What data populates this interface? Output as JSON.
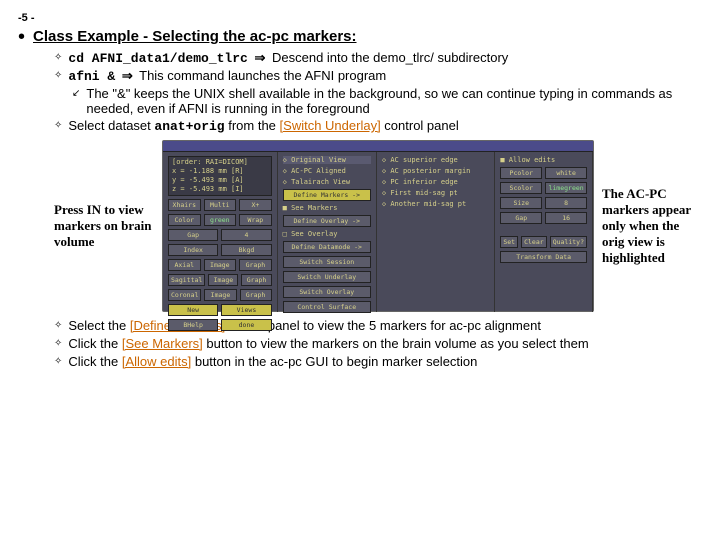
{
  "page_number": "-5 -",
  "title": "Class Example - Selecting the ac-pc markers:",
  "bullets": {
    "cd_cmd": "cd AFNI_data1/demo_tlrc",
    "cd_desc": "Descend into the demo_tlrc/ subdirectory",
    "afni_cmd": "afni &",
    "afni_desc": "This command launches the AFNI program",
    "amp_note": "The \"&\" keeps the UNIX shell available in the background, so we can continue typing in commands as needed, even if AFNI is running in the foreground",
    "select_pre": "Select dataset ",
    "select_ds": "anat+orig",
    "select_mid": " from the ",
    "select_link": "[Switch Underlay]",
    "select_post": " control panel"
  },
  "side_left": "Press IN to view markers on brain volume",
  "side_right": "The AC-PC markers appear only when the orig view is highlighted",
  "bottom": {
    "b1_pre": "Select the ",
    "b1_link": "[Define Markers]",
    "b1_post": "control panel to view the 5 markers for ac-pc alignment",
    "b2_pre": "Click the ",
    "b2_link": "[See Markers]",
    "b2_post": " button to view the markers on the brain volume as you select them",
    "b3_pre": "Click the ",
    "b3_link": "[Allow edits]",
    "b3_post": " button in the ac-pc GUI to begin marker selection"
  },
  "afni": {
    "order": "[order: RAI=DICOM]",
    "coord_x": "x = -1.188 mm [R]",
    "coord_y": "y = -5.493 mm [A]",
    "coord_z": "z = -5.493 mm [I]",
    "xhairs": "Xhairs",
    "multi": "Multi",
    "xl": "X+",
    "color": "Color",
    "green": "green",
    "wrap": "Wrap",
    "gap": "Gap",
    "gap_v": "4",
    "index": "Index",
    "bkgd": "Bkgd",
    "axial": "Axial",
    "image1": "Image",
    "graph1": "Graph",
    "sagittal": "Sagittal",
    "image2": "Image",
    "graph2": "Graph",
    "coronal": "Coronal",
    "image3": "Image",
    "graph3": "Graph",
    "new": "New",
    "views": "Views",
    "bhelp": "BHelp",
    "done": "done",
    "orig": "Original View",
    "acpc": "AC-PC Aligned",
    "tlrc": "Talairach View",
    "defm": "Define Markers ->",
    "seem": "See Markers",
    "defo": "Define Overlay ->",
    "seeo": "See Overlay",
    "defd": "Define Datamode ->",
    "swsess": "Switch Session",
    "swul": "Switch Underlay",
    "swol": "Switch Overlay",
    "ctrls": "Control Surface",
    "ac_sup": "AC superior edge",
    "ac_post": "AC posterior margin",
    "pc_inf": "PC inferior edge",
    "fmid": "First mid-sag pt",
    "amid": "Another mid-sag pt",
    "allow": "Allow edits",
    "pcolor": "Pcolor",
    "white": "white",
    "scolor": "Scolor",
    "limegreen": "limegreen",
    "size": "Size",
    "size_v": "8",
    "gap2": "Gap",
    "gap2_v": "16",
    "set": "Set",
    "clear": "Clear",
    "quality": "Quality?",
    "transform": "Transform Data"
  }
}
